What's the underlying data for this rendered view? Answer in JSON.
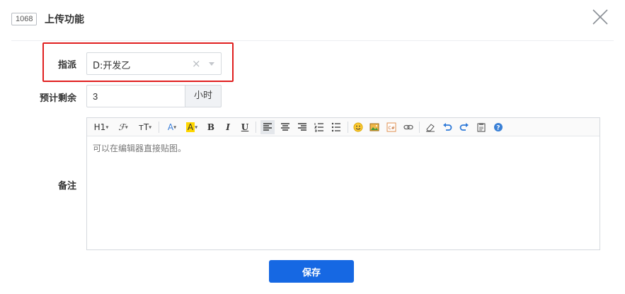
{
  "header": {
    "id": "1068",
    "title": "上传功能"
  },
  "form": {
    "assign": {
      "label": "指派",
      "value": "D:开发乙",
      "clear_glyph": "×"
    },
    "remaining": {
      "label": "预计剩余",
      "value": "3",
      "unit": "小时"
    },
    "notes": {
      "label": "备注",
      "placeholder": "可以在编辑器直接贴图。"
    }
  },
  "toolbar": {
    "heading": "H1",
    "font_family": "𝓕",
    "font_size": "тT",
    "font_color": "A",
    "bg_color": "A",
    "bold": "B",
    "italic": "I",
    "underline": "U"
  },
  "actions": {
    "save_label": "保存"
  },
  "colors": {
    "primary": "#1668e3",
    "highlight": "#e01f1f",
    "bg_color_swatch": "#ffd700",
    "font_color_icon": "#3b7fd9"
  }
}
